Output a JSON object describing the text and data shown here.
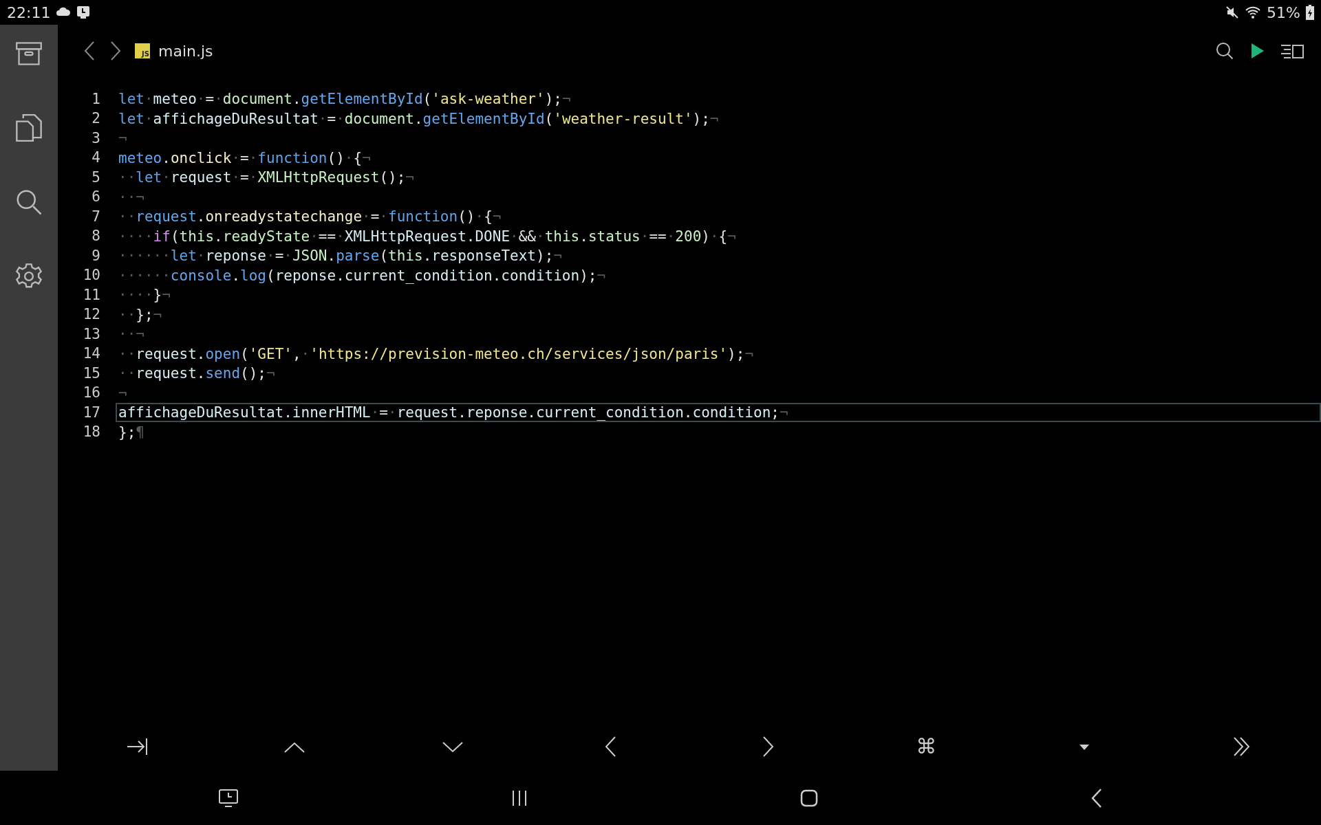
{
  "status_bar": {
    "time": "22:11",
    "battery": "51%"
  },
  "tab": {
    "file_badge": "JS",
    "file_name": "main.js"
  },
  "editor": {
    "lines": [
      {
        "number": "1",
        "current": false,
        "tokens": [
          {
            "kind": "kw",
            "text": "let"
          },
          {
            "kind": "ws",
            "text": "·"
          },
          {
            "kind": "id",
            "text": "meteo"
          },
          {
            "kind": "ws",
            "text": "·"
          },
          {
            "kind": "op",
            "text": "="
          },
          {
            "kind": "ws",
            "text": "·"
          },
          {
            "kind": "obj",
            "text": "document"
          },
          {
            "kind": "op",
            "text": "."
          },
          {
            "kind": "fn",
            "text": "getElementById"
          },
          {
            "kind": "op",
            "text": "("
          },
          {
            "kind": "str",
            "text": "'ask-weather'"
          },
          {
            "kind": "op",
            "text": ");"
          },
          {
            "kind": "ws",
            "text": "¬"
          }
        ]
      },
      {
        "number": "2",
        "current": false,
        "tokens": [
          {
            "kind": "kw",
            "text": "let"
          },
          {
            "kind": "ws",
            "text": "·"
          },
          {
            "kind": "id",
            "text": "affichageDuResultat"
          },
          {
            "kind": "ws",
            "text": "·"
          },
          {
            "kind": "op",
            "text": "="
          },
          {
            "kind": "ws",
            "text": "·"
          },
          {
            "kind": "obj",
            "text": "document"
          },
          {
            "kind": "op",
            "text": "."
          },
          {
            "kind": "fn",
            "text": "getElementById"
          },
          {
            "kind": "op",
            "text": "("
          },
          {
            "kind": "str",
            "text": "'weather-result'"
          },
          {
            "kind": "op",
            "text": ");"
          },
          {
            "kind": "ws",
            "text": "¬"
          }
        ]
      },
      {
        "number": "3",
        "current": false,
        "tokens": [
          {
            "kind": "ws",
            "text": "¬"
          }
        ]
      },
      {
        "number": "4",
        "current": false,
        "tokens": [
          {
            "kind": "fn",
            "text": "meteo"
          },
          {
            "kind": "op",
            "text": "."
          },
          {
            "kind": "prop",
            "text": "onclick"
          },
          {
            "kind": "ws",
            "text": "·"
          },
          {
            "kind": "op",
            "text": "="
          },
          {
            "kind": "ws",
            "text": "·"
          },
          {
            "kind": "kw",
            "text": "function"
          },
          {
            "kind": "op",
            "text": "()"
          },
          {
            "kind": "ws",
            "text": "·"
          },
          {
            "kind": "op",
            "text": "{"
          },
          {
            "kind": "ws",
            "text": "¬"
          }
        ]
      },
      {
        "number": "5",
        "current": false,
        "tokens": [
          {
            "kind": "ws",
            "text": "··"
          },
          {
            "kind": "kw",
            "text": "let"
          },
          {
            "kind": "ws",
            "text": "·"
          },
          {
            "kind": "id",
            "text": "request"
          },
          {
            "kind": "ws",
            "text": "·"
          },
          {
            "kind": "op",
            "text": "="
          },
          {
            "kind": "ws",
            "text": "·"
          },
          {
            "kind": "obj",
            "text": "XMLHttpRequest"
          },
          {
            "kind": "op",
            "text": "();"
          },
          {
            "kind": "ws",
            "text": "¬"
          }
        ]
      },
      {
        "number": "6",
        "current": false,
        "tokens": [
          {
            "kind": "ws",
            "text": "··¬"
          }
        ]
      },
      {
        "number": "7",
        "current": false,
        "tokens": [
          {
            "kind": "ws",
            "text": "··"
          },
          {
            "kind": "fn",
            "text": "request"
          },
          {
            "kind": "op",
            "text": "."
          },
          {
            "kind": "prop",
            "text": "onreadystatechange"
          },
          {
            "kind": "ws",
            "text": "·"
          },
          {
            "kind": "op",
            "text": "="
          },
          {
            "kind": "ws",
            "text": "·"
          },
          {
            "kind": "kw",
            "text": "function"
          },
          {
            "kind": "op",
            "text": "()"
          },
          {
            "kind": "ws",
            "text": "·"
          },
          {
            "kind": "op",
            "text": "{"
          },
          {
            "kind": "ws",
            "text": "¬"
          }
        ]
      },
      {
        "number": "8",
        "current": false,
        "tokens": [
          {
            "kind": "ws",
            "text": "····"
          },
          {
            "kind": "ctl",
            "text": "if"
          },
          {
            "kind": "op",
            "text": "("
          },
          {
            "kind": "obj",
            "text": "this"
          },
          {
            "kind": "op",
            "text": "."
          },
          {
            "kind": "obj",
            "text": "readyState"
          },
          {
            "kind": "ws",
            "text": "·"
          },
          {
            "kind": "op",
            "text": "=="
          },
          {
            "kind": "ws",
            "text": "·"
          },
          {
            "kind": "id",
            "text": "XMLHttpRequest.DONE"
          },
          {
            "kind": "ws",
            "text": "·"
          },
          {
            "kind": "op",
            "text": "&&"
          },
          {
            "kind": "ws",
            "text": "·"
          },
          {
            "kind": "obj",
            "text": "this"
          },
          {
            "kind": "op",
            "text": "."
          },
          {
            "kind": "obj",
            "text": "status"
          },
          {
            "kind": "ws",
            "text": "·"
          },
          {
            "kind": "op",
            "text": "=="
          },
          {
            "kind": "ws",
            "text": "·"
          },
          {
            "kind": "num",
            "text": "200"
          },
          {
            "kind": "op",
            "text": ")"
          },
          {
            "kind": "ws",
            "text": "·"
          },
          {
            "kind": "op",
            "text": "{"
          },
          {
            "kind": "ws",
            "text": "¬"
          }
        ]
      },
      {
        "number": "9",
        "current": false,
        "tokens": [
          {
            "kind": "ws",
            "text": "······"
          },
          {
            "kind": "kw",
            "text": "let"
          },
          {
            "kind": "ws",
            "text": "·"
          },
          {
            "kind": "id",
            "text": "reponse"
          },
          {
            "kind": "ws",
            "text": "·"
          },
          {
            "kind": "op",
            "text": "="
          },
          {
            "kind": "ws",
            "text": "·"
          },
          {
            "kind": "obj",
            "text": "JSON"
          },
          {
            "kind": "op",
            "text": "."
          },
          {
            "kind": "fn",
            "text": "parse"
          },
          {
            "kind": "op",
            "text": "("
          },
          {
            "kind": "obj",
            "text": "this"
          },
          {
            "kind": "op",
            "text": "."
          },
          {
            "kind": "id",
            "text": "responseText"
          },
          {
            "kind": "op",
            "text": ");"
          },
          {
            "kind": "ws",
            "text": "¬"
          }
        ]
      },
      {
        "number": "10",
        "current": false,
        "tokens": [
          {
            "kind": "ws",
            "text": "······"
          },
          {
            "kind": "fn",
            "text": "console"
          },
          {
            "kind": "op",
            "text": "."
          },
          {
            "kind": "fn",
            "text": "log"
          },
          {
            "kind": "op",
            "text": "("
          },
          {
            "kind": "id",
            "text": "reponse.current_condition.condition"
          },
          {
            "kind": "op",
            "text": ");"
          },
          {
            "kind": "ws",
            "text": "¬"
          }
        ]
      },
      {
        "number": "11",
        "current": false,
        "tokens": [
          {
            "kind": "ws",
            "text": "····"
          },
          {
            "kind": "op",
            "text": "}"
          },
          {
            "kind": "ws",
            "text": "¬"
          }
        ]
      },
      {
        "number": "12",
        "current": false,
        "tokens": [
          {
            "kind": "ws",
            "text": "··"
          },
          {
            "kind": "op",
            "text": "};"
          },
          {
            "kind": "ws",
            "text": "¬"
          }
        ]
      },
      {
        "number": "13",
        "current": false,
        "tokens": [
          {
            "kind": "ws",
            "text": "··¬"
          }
        ]
      },
      {
        "number": "14",
        "current": false,
        "tokens": [
          {
            "kind": "ws",
            "text": "··"
          },
          {
            "kind": "id",
            "text": "request"
          },
          {
            "kind": "op",
            "text": "."
          },
          {
            "kind": "fn",
            "text": "open"
          },
          {
            "kind": "op",
            "text": "("
          },
          {
            "kind": "str",
            "text": "'GET'"
          },
          {
            "kind": "op",
            "text": ","
          },
          {
            "kind": "ws",
            "text": "·"
          },
          {
            "kind": "str",
            "text": "'https://prevision-meteo.ch/services/json/paris'"
          },
          {
            "kind": "op",
            "text": ");"
          },
          {
            "kind": "ws",
            "text": "¬"
          }
        ]
      },
      {
        "number": "15",
        "current": false,
        "tokens": [
          {
            "kind": "ws",
            "text": "··"
          },
          {
            "kind": "id",
            "text": "request"
          },
          {
            "kind": "op",
            "text": "."
          },
          {
            "kind": "fn",
            "text": "send"
          },
          {
            "kind": "op",
            "text": "();"
          },
          {
            "kind": "ws",
            "text": "¬"
          }
        ]
      },
      {
        "number": "16",
        "current": false,
        "tokens": [
          {
            "kind": "ws",
            "text": "¬"
          }
        ]
      },
      {
        "number": "17",
        "current": true,
        "tokens": [
          {
            "kind": "id",
            "text": "affichageDuResultat.innerHTML"
          },
          {
            "kind": "ws",
            "text": "·"
          },
          {
            "kind": "op",
            "text": "="
          },
          {
            "kind": "ws",
            "text": "·"
          },
          {
            "kind": "id",
            "text": "request.reponse.current_condition.condition"
          },
          {
            "kind": "op",
            "text": ";"
          },
          {
            "kind": "ws",
            "text": "¬"
          }
        ]
      },
      {
        "number": "18",
        "current": false,
        "tokens": [
          {
            "kind": "op",
            "text": "};"
          },
          {
            "kind": "ws",
            "text": "¶"
          }
        ]
      }
    ]
  },
  "key_bar": {
    "command_key": "⌘"
  }
}
